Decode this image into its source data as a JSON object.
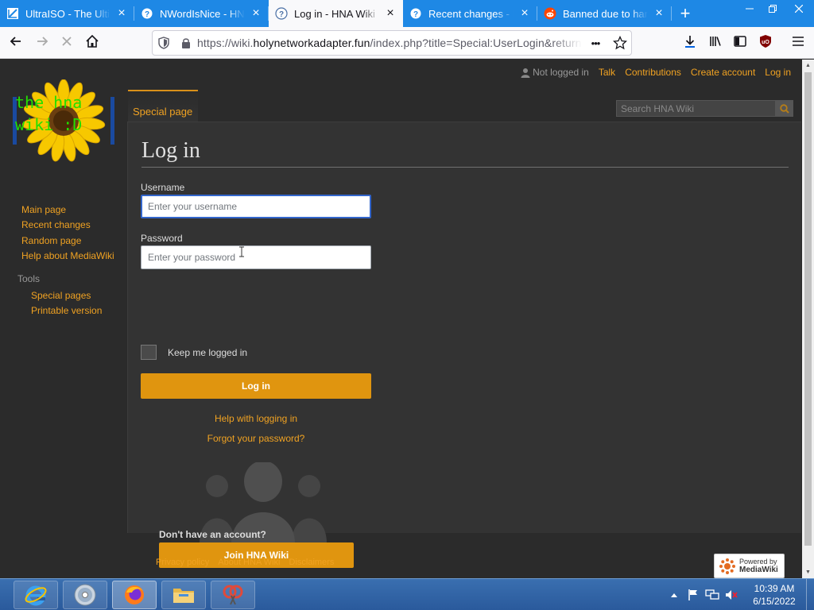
{
  "browser": {
    "tabs": [
      {
        "title": "UltraISO - The Ultim",
        "icon": "ultraiso-icon",
        "active": false
      },
      {
        "title": "NWordIsNice - HNA",
        "icon": "wiki-icon",
        "active": false
      },
      {
        "title": "Log in - HNA Wiki",
        "icon": "wiki-icon",
        "active": true
      },
      {
        "title": "Recent changes - HN",
        "icon": "wiki-icon",
        "active": false
      },
      {
        "title": "Banned due to haras",
        "icon": "reddit-icon",
        "active": false
      }
    ],
    "new_tab": "+",
    "url_prefix": "https://wiki.",
    "url_domain": "holynetworkadapter.fun",
    "url_rest": "/index.php?title=Special:UserLogin&returnto=",
    "page_actions": "•••"
  },
  "personal": {
    "status": "Not logged in",
    "links": [
      "Talk",
      "Contributions",
      "Create account",
      "Log in"
    ]
  },
  "logo": {
    "text_line1": "the hna",
    "text_line2": "wiki :D"
  },
  "tabs": {
    "special": "Special page"
  },
  "search": {
    "placeholder": "Search HNA Wiki"
  },
  "sidebar": {
    "nav": [
      "Main page",
      "Recent changes",
      "Random page",
      "Help about MediaWiki"
    ],
    "tools_heading": "Tools",
    "tools": [
      "Special pages",
      "Printable version"
    ]
  },
  "login": {
    "heading": "Log in",
    "username_label": "Username",
    "username_placeholder": "Enter your username",
    "password_label": "Password",
    "password_placeholder": "Enter your password",
    "remember": "Keep me logged in",
    "submit": "Log in",
    "help": "Help with logging in",
    "forgot": "Forgot your password?",
    "no_account": "Don't have an account?",
    "join": "Join HNA Wiki"
  },
  "footer": {
    "links": [
      "Privacy policy",
      "About HNA Wiki",
      "Disclaimers"
    ],
    "powered_line1": "Powered by",
    "powered_line2": "MediaWiki"
  },
  "taskbar": {
    "time": "10:39 AM",
    "date": "6/15/2022"
  },
  "colors": {
    "link": "#f0a222",
    "button": "#e0950f",
    "background": "#2b2b2b",
    "content": "#333333",
    "tabbar": "#1e88e5"
  }
}
